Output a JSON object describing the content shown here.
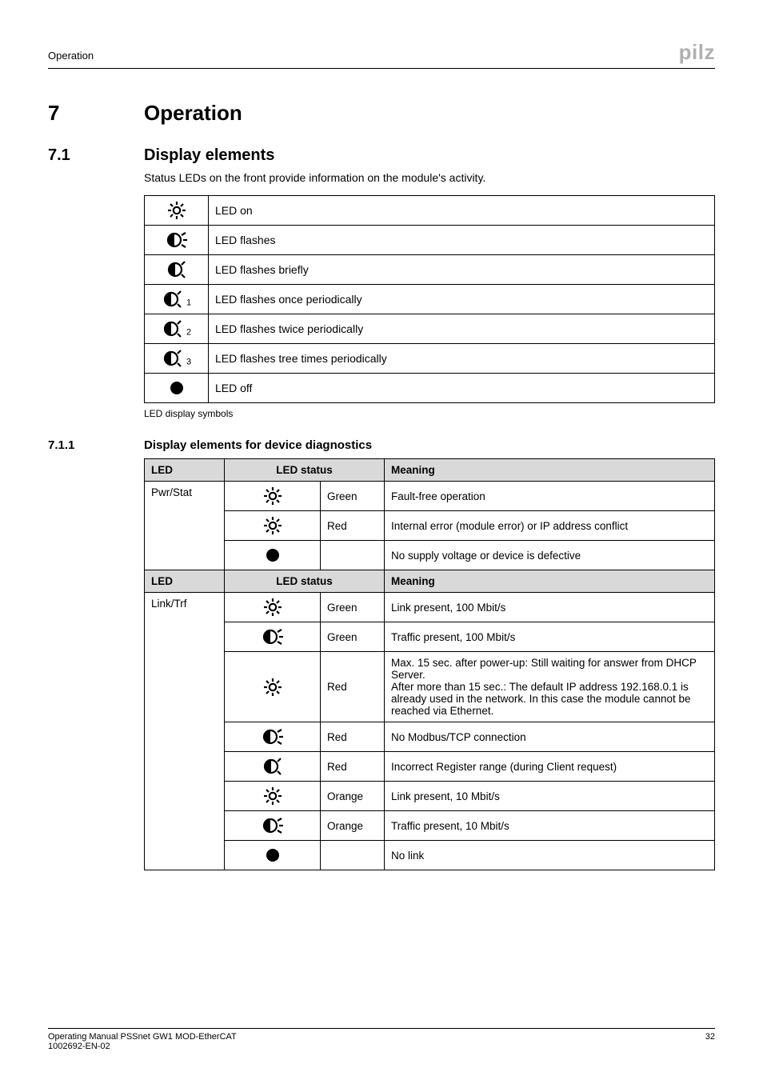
{
  "header": {
    "section_label": "Operation",
    "logo_text": "pilz"
  },
  "sections": {
    "num7": "7",
    "title7": "Operation",
    "num71": "7.1",
    "title71": "Display elements",
    "intro71": "Status LEDs on the front provide information on the module's activity.",
    "num711": "7.1.1",
    "title711": "Display elements for device diagnostics"
  },
  "symbols": {
    "rows": [
      {
        "desc": "LED on"
      },
      {
        "desc": "LED flashes"
      },
      {
        "desc": "LED flashes briefly"
      },
      {
        "desc": "LED flashes once periodically"
      },
      {
        "desc": "LED flashes twice periodically"
      },
      {
        "desc": "LED flashes tree times periodically"
      },
      {
        "desc": "LED off"
      }
    ],
    "caption": "LED display symbols"
  },
  "diag": {
    "headers": {
      "led": "LED",
      "status": "LED status",
      "meaning": "Meaning"
    },
    "pwrstat_label": "Pwr/Stat",
    "linktrf_label": "Link/Trf",
    "colors": {
      "green": "Green",
      "red": "Red",
      "orange": "Orange"
    },
    "meanings": {
      "fault_free": "Fault-free operation",
      "internal_error": "Internal error (module error) or IP address conflict",
      "no_supply": "No supply voltage or device is defective",
      "link100": "Link present, 100 Mbit/s",
      "traffic100": "Traffic present, 100 Mbit/s",
      "max15": "Max. 15 sec. after power-up: Still waiting for answer from DHCP Server.\nAfter more than 15 sec.: The default IP address 192.168.0.1 is already used in the network. In this case the module cannot be reached via Ethernet.",
      "nomodbus": "No Modbus/TCP connection",
      "incorrect_reg": "Incorrect Register range (during Client request)",
      "link10": "Link present, 10 Mbit/s",
      "traffic10": "Traffic present, 10 Mbit/s",
      "nolink": "No link"
    }
  },
  "footer": {
    "line1": "Operating Manual PSSnet GW1 MOD-EtherCAT",
    "line2": "1002692-EN-02",
    "page": "32"
  }
}
